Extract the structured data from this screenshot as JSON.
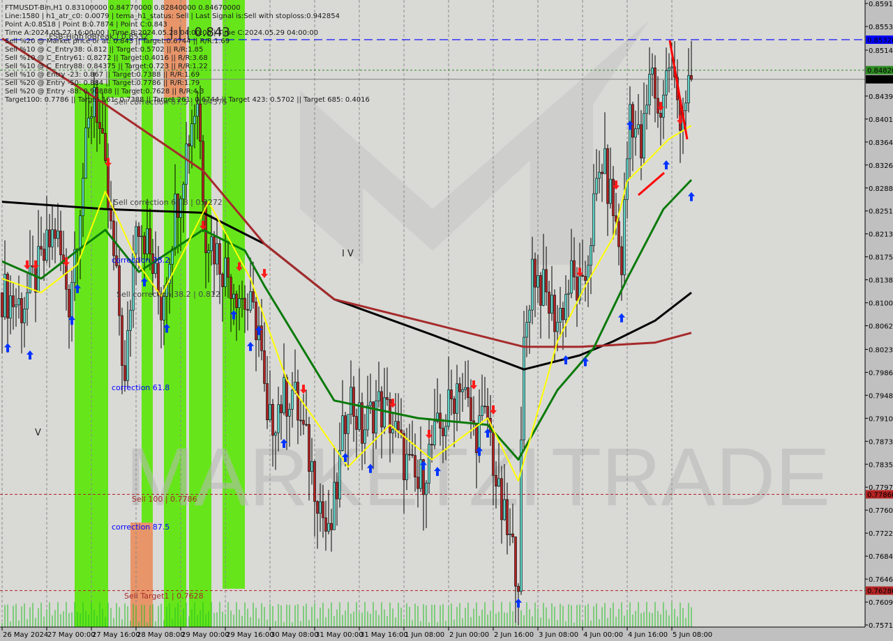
{
  "header": {
    "symbol_line": "FTMUSDT-Bin,H1  0.83100000 0.84770000 0.82840000 0.84670000",
    "lines": [
      "Line:1580 | h1_atr_c0: 0.0079 | tema_h1_status: Sell | Last Signal is:Sell with stoploss:0.942854",
      "Point A:0.8518 | Point B:0.7874 | Point C:0.843",
      "Time A:2024.05.27 16:00:00 | Time B:2024.05.28 04:00:00 | Time C:2024.05.29 04:00:00",
      "Sell %20 @ Market price or at: 0.843 || Target:0.6744 || R/R:1.69",
      "Sell %10 @ C_Entry38: 0.812 || Target:0.5702 || R/R:1.85",
      "Sell %10 @ C_Entry61: 0.8272 || Target:0.4016 || R/R:3.68",
      "Sell %10 @ C_Entry88: 0.84375 || Target:0.723 || R/R:1.22",
      "Sell %10 @ Entry -23: 0.867 || Target:0.7388 || R/R:1.69",
      "Sell %20 @ Entry -50: 0.884 || Target:0.7786 || R/R:1.79",
      "Sell %20 @ Entry -88: 0.90888 || Target:0.7628 || R/R:4.3",
      "Target100: 0.7786 || Target 161: 0.7388 || Target 261: 0.6744 || Target 423: 0.5702 || Target 685: 0.4016"
    ]
  },
  "annotations": {
    "fsb": "FSB-HighToBreak | 0.8532",
    "point_c": "| | | 0.843",
    "sell_corr_875": "Sell correction 87.5 | 0.84375",
    "sell_corr_618": "Sell correction 61.8 | 0.8272",
    "corr_382": "correction 38.2",
    "sell_corr_382": "Sell correction 38.2 | 0.812",
    "corr_618": "correction 61.8",
    "sell_100": "Sell 100 | 0.7786",
    "corr_875": "correction 87.5",
    "sell_target1": "Sell Target1 | 0.7628",
    "wave_iv": "I V",
    "wave_v": "V"
  },
  "watermark": {
    "left": "MARKETZI",
    "right": "TRADE"
  },
  "price_tags": [
    {
      "value": "0.85320",
      "bg": "#0000ff",
      "fg": "#ffffff"
    },
    {
      "value": "0.84820",
      "bg": "#2e8b22",
      "fg": "#c8e8c0"
    },
    {
      "value": "0.84670",
      "bg": "#000000",
      "fg": "#ffffff"
    },
    {
      "value": "0.77860",
      "bg": "#b22222",
      "fg": "#f0c8c8"
    },
    {
      "value": "0.76280",
      "bg": "#b22222",
      "fg": "#f0c8c8"
    }
  ],
  "chart_data": {
    "type": "candlestick",
    "timeframe": "H1",
    "ylim": [
      0.75716,
      0.85914
    ],
    "y_ticks": [
      "0.85914",
      "0.85537",
      "0.85148",
      "0.84395",
      "0.84018",
      "0.83641",
      "0.83264",
      "0.82887",
      "0.82510",
      "0.82134",
      "0.81757",
      "0.81380",
      "0.81003",
      "0.80626",
      "0.80238",
      "0.79861",
      "0.79484",
      "0.79107",
      "0.78730",
      "0.78354",
      "0.77977",
      "0.77600",
      "0.77223",
      "0.76846",
      "0.76469",
      "0.76092",
      "0.75716"
    ],
    "x_ticks": [
      "26 May 2024",
      "27 May 00:00",
      "27 May 16:00",
      "28 May 08:00",
      "29 May 00:00",
      "29 May 16:00",
      "30 May 08:00",
      "31 May 00:00",
      "31 May 16:00",
      "1 Jun 08:00",
      "2 Jun 00:00",
      "2 Jun 16:00",
      "3 Jun 08:00",
      "4 Jun 00:00",
      "4 Jun 16:00",
      "5 Jun 08:00"
    ],
    "grid": "vertical dashed",
    "levels": [
      {
        "price": 0.8532,
        "color": "#0000ff",
        "style": "dashed"
      },
      {
        "price": 0.8482,
        "color": "#2e8b22",
        "style": "dotted"
      },
      {
        "price": 0.8467,
        "color": "#808080",
        "style": "solid"
      },
      {
        "price": 0.7786,
        "color": "#b22222",
        "style": "dashed"
      },
      {
        "price": 0.7628,
        "color": "#b22222",
        "style": "dashed"
      }
    ],
    "close_path": [
      [
        "2024-05-26 08:00",
        0.8117
      ],
      [
        "2024-05-26 15:00",
        0.8094
      ],
      [
        "2024-05-26 22:00",
        0.8163
      ],
      [
        "2024-05-27 03:00",
        0.822
      ],
      [
        "2024-05-27 08:00",
        0.8106
      ],
      [
        "2024-05-27 13:00",
        0.8311
      ],
      [
        "2024-05-27 17:00",
        0.846
      ],
      [
        "2024-05-27 21:00",
        0.83
      ],
      [
        "2024-05-28 02:00",
        0.8083
      ],
      [
        "2024-05-28 04:00",
        0.7957
      ],
      [
        "2024-05-28 08:00",
        0.8254
      ],
      [
        "2024-05-28 12:00",
        0.8197
      ],
      [
        "2024-05-28 17:00",
        0.8094
      ],
      [
        "2024-05-28 22:00",
        0.8254
      ],
      [
        "2024-05-29 04:00",
        0.8403
      ],
      [
        "2024-05-29 06:00",
        0.8437
      ],
      [
        "2024-05-29 09:00",
        0.822
      ],
      [
        "2024-05-29 15:00",
        0.8163
      ],
      [
        "2024-05-29 21:00",
        0.8117
      ],
      [
        "2024-05-30 04:00",
        0.806
      ],
      [
        "2024-05-30 07:00",
        0.7888
      ],
      [
        "2024-05-30 11:00",
        0.7934
      ],
      [
        "2024-05-30 16:00",
        0.7957
      ],
      [
        "2024-05-30 21:00",
        0.7865
      ],
      [
        "2024-05-31 02:00",
        0.7774
      ],
      [
        "2024-05-31 05:00",
        0.7705
      ],
      [
        "2024-05-31 08:00",
        0.7797
      ],
      [
        "2024-05-31 12:00",
        0.7957
      ],
      [
        "2024-05-31 17:00",
        0.7888
      ],
      [
        "2024-05-31 22:00",
        0.7934
      ],
      [
        "2024-06-01 03:00",
        0.7911
      ],
      [
        "2024-06-01 08:00",
        0.7843
      ],
      [
        "2024-06-01 13:00",
        0.7797
      ],
      [
        "2024-06-01 18:00",
        0.7865
      ],
      [
        "2024-06-01 23:00",
        0.7911
      ],
      [
        "2024-06-02 04:00",
        0.798
      ],
      [
        "2024-06-02 09:00",
        0.7888
      ],
      [
        "2024-06-02 14:00",
        0.7911
      ],
      [
        "2024-06-02 18:00",
        0.7774
      ],
      [
        "2024-06-02 22:00",
        0.7705
      ],
      [
        "2024-06-03 01:00",
        0.766
      ],
      [
        "2024-06-03 03:00",
        0.8026
      ],
      [
        "2024-06-03 06:00",
        0.8163
      ],
      [
        "2024-06-03 10:00",
        0.8117
      ],
      [
        "2024-06-03 15:00",
        0.8071
      ],
      [
        "2024-06-03 20:00",
        0.814
      ],
      [
        "2024-06-04 00:00",
        0.8106
      ],
      [
        "2024-06-04 04:00",
        0.8254
      ],
      [
        "2024-06-04 07:00",
        0.8334
      ],
      [
        "2024-06-04 11:00",
        0.8254
      ],
      [
        "2024-06-04 14:00",
        0.8163
      ],
      [
        "2024-06-04 17:00",
        0.8426
      ],
      [
        "2024-06-04 21:00",
        0.8346
      ],
      [
        "2024-06-05 01:00",
        0.8494
      ],
      [
        "2024-06-05 03:00",
        0.8403
      ],
      [
        "2024-06-05 07:00",
        0.8494
      ],
      [
        "2024-06-05 11:00",
        0.8414
      ],
      [
        "2024-06-05 15:00",
        0.8467
      ]
    ],
    "series": [
      {
        "color": "#000000",
        "points": [
          [
            "2024-05-26 08:00",
            0.8266
          ],
          [
            "2024-05-27 21:00",
            0.8254
          ],
          [
            "2024-05-29 08:00",
            0.8248
          ],
          [
            "2024-05-30 06:00",
            0.8197
          ],
          [
            "2024-05-31 07:00",
            0.8106
          ],
          [
            "2024-06-01 18:00",
            0.8048
          ],
          [
            "2024-06-03 03:00",
            0.7991
          ],
          [
            "2024-06-03 23:00",
            0.8014
          ],
          [
            "2024-06-04 11:00",
            0.8037
          ],
          [
            "2024-06-05 02:00",
            0.8071
          ],
          [
            "2024-06-05 15:00",
            0.8117
          ]
        ]
      },
      {
        "color": "#a52a2a",
        "points": [
          [
            "2024-05-26 08:00",
            0.8534
          ],
          [
            "2024-05-27 21:00",
            0.8426
          ],
          [
            "2024-05-29 08:00",
            0.8317
          ],
          [
            "2024-05-30 06:00",
            0.8197
          ],
          [
            "2024-05-31 07:00",
            0.8106
          ],
          [
            "2024-06-01 18:00",
            0.8066
          ],
          [
            "2024-06-03 03:00",
            0.8028
          ],
          [
            "2024-06-03 23:00",
            0.8028
          ],
          [
            "2024-06-04 11:00",
            0.8031
          ],
          [
            "2024-06-05 02:00",
            0.8035
          ],
          [
            "2024-06-05 15:00",
            0.8051
          ]
        ]
      },
      {
        "color": "#0a7a0a",
        "points": [
          [
            "2024-05-26 08:00",
            0.8168
          ],
          [
            "2024-05-26 22:00",
            0.814
          ],
          [
            "2024-05-27 11:00",
            0.8186
          ],
          [
            "2024-05-27 21:00",
            0.822
          ],
          [
            "2024-05-28 09:00",
            0.8151
          ],
          [
            "2024-05-29 08:00",
            0.822
          ],
          [
            "2024-05-29 23:00",
            0.8186
          ],
          [
            "2024-05-30 06:00",
            0.8128
          ],
          [
            "2024-05-31 07:00",
            0.794
          ],
          [
            "2024-06-01 13:00",
            0.7911
          ],
          [
            "2024-06-02 14:00",
            0.79
          ],
          [
            "2024-06-03 01:00",
            0.7843
          ],
          [
            "2024-06-03 15:00",
            0.7957
          ],
          [
            "2024-06-04 04:00",
            0.8026
          ],
          [
            "2024-06-04 16:00",
            0.814
          ],
          [
            "2024-06-05 05:00",
            0.8254
          ],
          [
            "2024-06-05 15:00",
            0.8302
          ]
        ]
      },
      {
        "color": "#ffff00",
        "points": [
          [
            "2024-05-26 08:00",
            0.814
          ],
          [
            "2024-05-26 22:00",
            0.8117
          ],
          [
            "2024-05-27 11:00",
            0.8163
          ],
          [
            "2024-05-27 21:00",
            0.8283
          ],
          [
            "2024-05-28 09:00",
            0.8163
          ],
          [
            "2024-05-28 17:00",
            0.8111
          ],
          [
            "2024-05-29 10:00",
            0.8266
          ],
          [
            "2024-05-30 01:00",
            0.814
          ],
          [
            "2024-05-30 14:00",
            0.7974
          ],
          [
            "2024-05-31 12:00",
            0.7831
          ],
          [
            "2024-06-01 03:00",
            0.79
          ],
          [
            "2024-06-01 18:00",
            0.7843
          ],
          [
            "2024-06-02 14:00",
            0.7911
          ],
          [
            "2024-06-03 01:00",
            0.7808
          ],
          [
            "2024-06-03 15:00",
            0.8037
          ],
          [
            "2024-06-04 01:00",
            0.8128
          ],
          [
            "2024-06-04 11:00",
            0.8208
          ],
          [
            "2024-06-04 16:00",
            0.83
          ],
          [
            "2024-06-05 07:00",
            0.8369
          ],
          [
            "2024-06-05 15:00",
            0.8391
          ]
        ]
      }
    ],
    "buy_signals": [
      [
        "2024-05-26 10:00",
        0.8026
      ],
      [
        "2024-05-26 18:00",
        0.8014
      ],
      [
        "2024-05-27 09:00",
        0.8071
      ],
      [
        "2024-05-27 11:00",
        0.8123
      ],
      [
        "2024-05-28 11:00",
        0.8134
      ],
      [
        "2024-05-28 19:00",
        0.8058
      ],
      [
        "2024-05-29 19:00",
        0.808
      ],
      [
        "2024-05-30 01:00",
        0.8028
      ],
      [
        "2024-05-30 04:00",
        0.8054
      ],
      [
        "2024-05-30 13:00",
        0.7869
      ],
      [
        "2024-05-31 11:00",
        0.7846
      ],
      [
        "2024-05-31 20:00",
        0.7828
      ],
      [
        "2024-06-01 15:00",
        0.7833
      ],
      [
        "2024-06-01 20:00",
        0.7823
      ],
      [
        "2024-06-02 11:00",
        0.7856
      ],
      [
        "2024-06-02 14:00",
        0.7886
      ],
      [
        "2024-06-03 01:00",
        0.7607
      ],
      [
        "2024-06-03 18:00",
        0.8006
      ],
      [
        "2024-06-04 01:00",
        0.8003
      ],
      [
        "2024-06-04 14:00",
        0.8075
      ],
      [
        "2024-06-04 17:00",
        0.8391
      ],
      [
        "2024-06-05 06:00",
        0.8326
      ],
      [
        "2024-06-05 15:00",
        0.8274
      ]
    ],
    "sell_signals": [
      [
        "2024-05-26 17:00",
        0.8163
      ],
      [
        "2024-05-26 20:00",
        0.8163
      ],
      [
        "2024-05-27 07:00",
        0.8168
      ],
      [
        "2024-05-27 22:00",
        0.8331
      ],
      [
        "2024-05-29 08:00",
        0.8228
      ],
      [
        "2024-05-29 21:00",
        0.816
      ],
      [
        "2024-05-30 06:00",
        0.8149
      ],
      [
        "2024-05-30 20:00",
        0.7959
      ],
      [
        "2024-06-01 04:00",
        0.7936
      ],
      [
        "2024-06-01 17:00",
        0.7885
      ],
      [
        "2024-06-02 09:00",
        0.7966
      ],
      [
        "2024-06-02 16:00",
        0.7925
      ],
      [
        "2024-06-03 23:00",
        0.8151
      ],
      [
        "2024-06-04 12:00",
        0.8294
      ],
      [
        "2024-06-05 04:00",
        0.8423
      ],
      [
        "2024-06-05 11:00",
        0.8401
      ]
    ],
    "colors": {
      "bull": "#5fd3c8",
      "bear": "#b22222",
      "buy": "#0033ff",
      "sell": "#ff1a1a",
      "zone_green": "#66e61a",
      "zone_orange": "#e8956a"
    }
  }
}
